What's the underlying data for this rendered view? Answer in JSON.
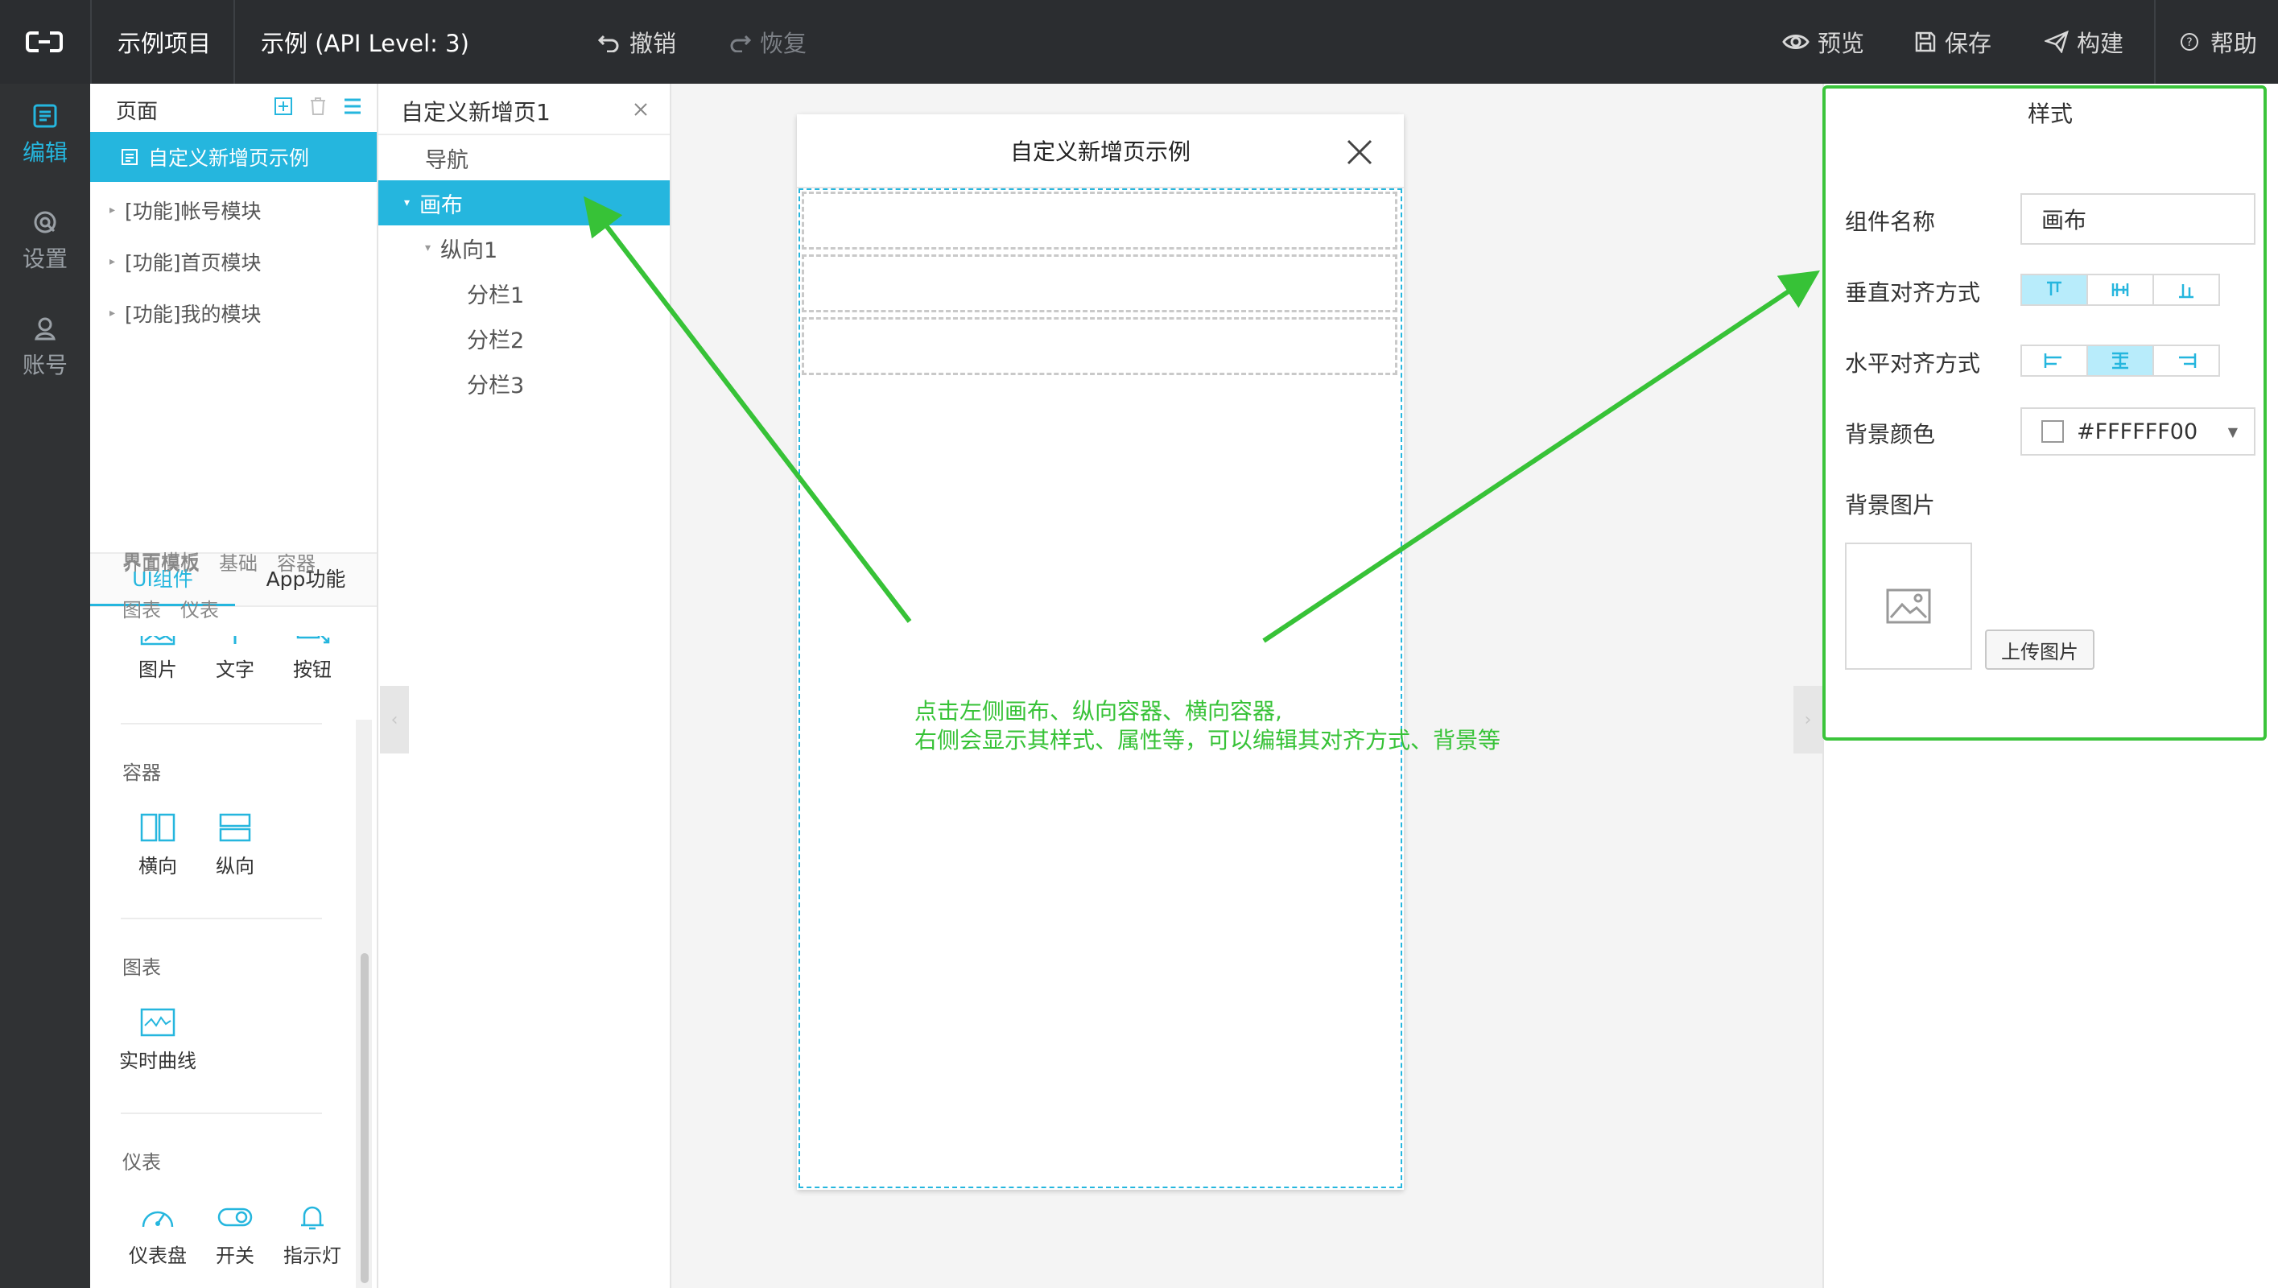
{
  "topbar": {
    "project": "示例项目",
    "app_name": "示例 (API Level: 3)",
    "undo": "撤销",
    "redo": "恢复",
    "preview": "预览",
    "save": "保存",
    "build": "构建",
    "help": "帮助"
  },
  "rail": {
    "edit": "编辑",
    "settings": "设置",
    "account": "账号"
  },
  "pages_panel": {
    "title": "页面",
    "items": [
      "自定义新增页示例",
      "[功能]帐号模块",
      "[功能]首页模块",
      "[功能]我的模块"
    ],
    "active_index": 0
  },
  "component_tabs": {
    "ui": "UI组件",
    "app": "App功能",
    "active": "ui"
  },
  "categories": [
    "界面模板",
    "基础",
    "容器",
    "图表",
    "仪表"
  ],
  "basic_components": [
    "图片",
    "文字",
    "按钮"
  ],
  "container_section": {
    "title": "容器",
    "items": [
      "横向",
      "纵向"
    ]
  },
  "chart_section": {
    "title": "图表",
    "items": [
      "实时曲线"
    ]
  },
  "gauge_section": {
    "title": "仪表",
    "items": [
      "仪表盘",
      "开关",
      "指示灯"
    ]
  },
  "tree_panel": {
    "tab_title": "自定义新增页1",
    "nav": "导航",
    "canvas": "画布",
    "vertical": "纵向1",
    "columns": [
      "分栏1",
      "分栏2",
      "分栏3"
    ]
  },
  "phone": {
    "title": "自定义新增页示例"
  },
  "style_panel": {
    "title": "样式",
    "component_name_label": "组件名称",
    "component_name_value": "画布",
    "valign_label": "垂直对齐方式",
    "halign_label": "水平对齐方式",
    "bg_color_label": "背景颜色",
    "bg_color_value": "#FFFFFF00",
    "bg_image_label": "背景图片",
    "upload_button": "上传图片"
  },
  "annotation": {
    "line1": "点击左侧画布、纵向容器、横向容器,",
    "line2": "右侧会显示其样式、属性等，可以编辑其对齐方式、背景等"
  },
  "colors": {
    "accent": "#25b6de",
    "topbar": "#2b2d30",
    "rail": "#303234",
    "annotation": "#37c237"
  }
}
